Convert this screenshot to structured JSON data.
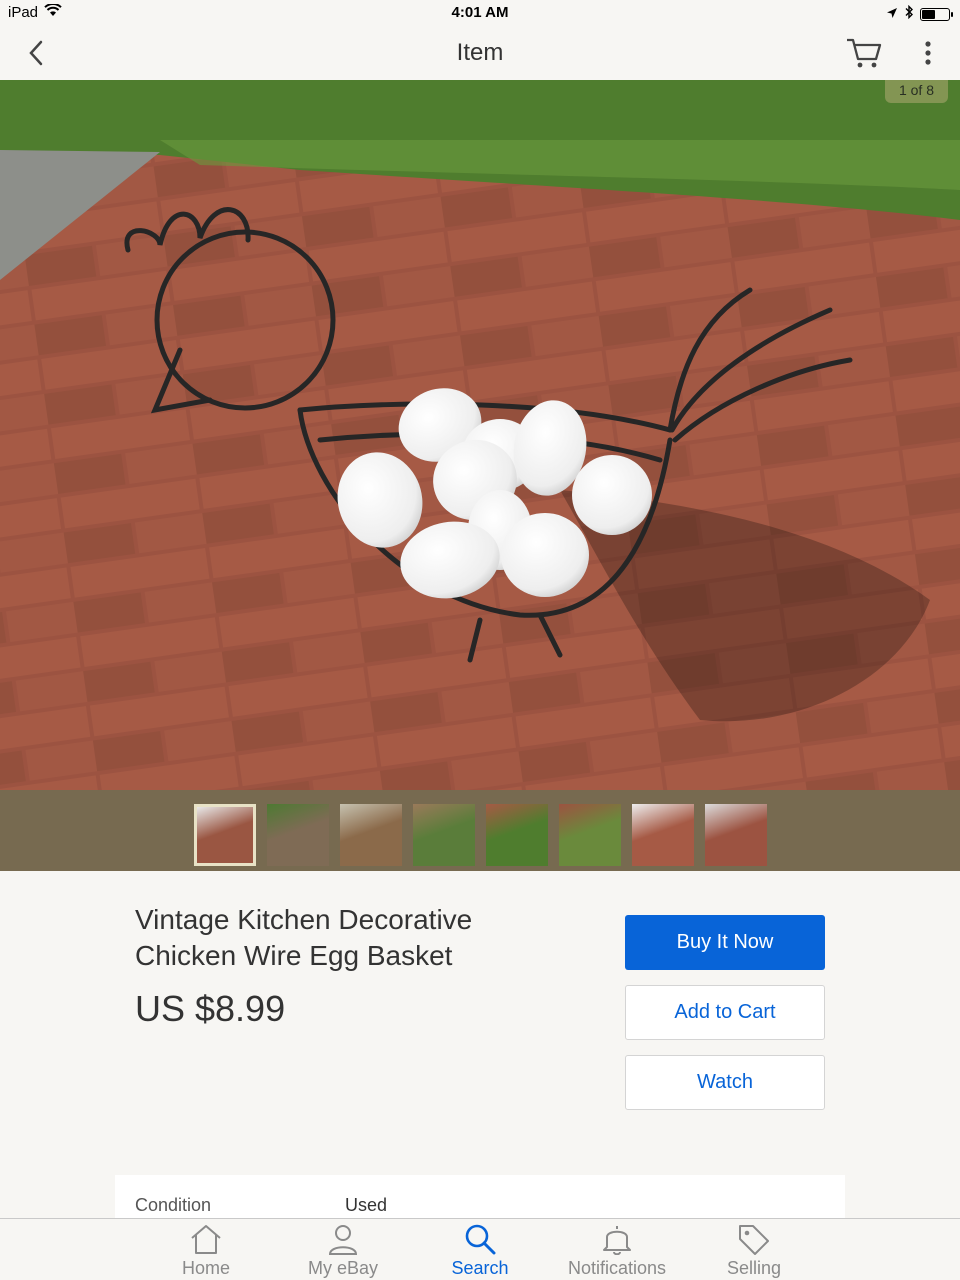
{
  "status_bar": {
    "device": "iPad",
    "time": "4:01 AM",
    "battery_level": 0.45
  },
  "nav": {
    "title": "Item"
  },
  "gallery": {
    "counter": "1 of 8",
    "thumbnail_count": 8,
    "selected_index": 0
  },
  "item": {
    "title": "Vintage Kitchen Decorative Chicken Wire Egg Basket",
    "price": "US $8.99"
  },
  "actions": {
    "buy_now": "Buy It Now",
    "add_to_cart": "Add to Cart",
    "watch": "Watch"
  },
  "details": {
    "condition_label": "Condition",
    "condition_value": "Used"
  },
  "tabs": [
    {
      "label": "Home",
      "icon": "home-icon"
    },
    {
      "label": "My eBay",
      "icon": "person-icon"
    },
    {
      "label": "Search",
      "icon": "search-icon"
    },
    {
      "label": "Notifications",
      "icon": "bell-icon"
    },
    {
      "label": "Selling",
      "icon": "tag-icon"
    }
  ],
  "colors": {
    "accent": "#0864d8",
    "thumb_strip": "#776a50",
    "background": "#f7f6f3"
  }
}
